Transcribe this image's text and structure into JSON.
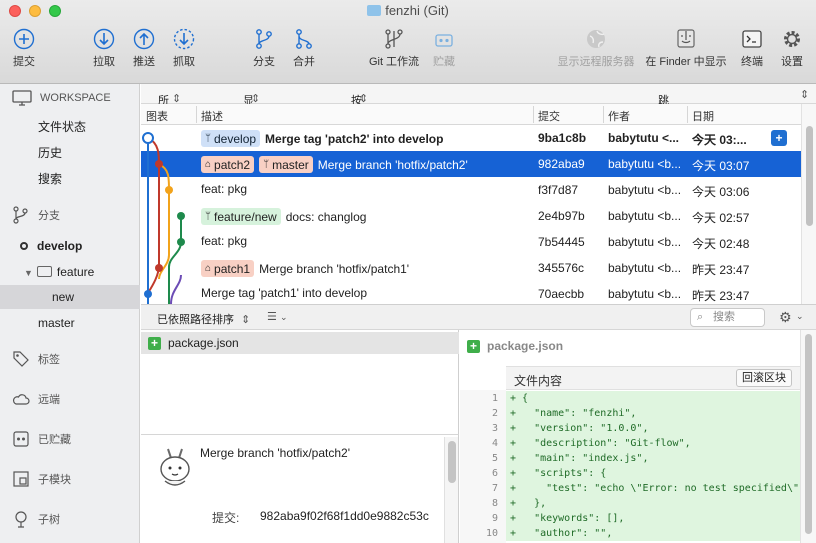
{
  "window": {
    "title": "fenzhi (Git)"
  },
  "toolbar": {
    "commit": "提交",
    "pull": "拉取",
    "push": "推送",
    "fetch": "抓取",
    "branch": "分支",
    "merge": "合并",
    "gitflow": "Git 工作流",
    "stash": "贮藏",
    "remote": "显示远程服务器",
    "finder": "在 Finder 中显示",
    "terminal": "终端",
    "settings": "设置"
  },
  "sidebar": {
    "workspace": "WORKSPACE",
    "workspace_items": [
      "文件状态",
      "历史",
      "搜索"
    ],
    "branches_header": "分支",
    "branches": {
      "develop": "develop",
      "feature": "feature",
      "new": "new",
      "master": "master"
    },
    "tags": "标签",
    "remotes": "远端",
    "stashes": "已贮藏",
    "submodules": "子模块",
    "subtrees": "子树"
  },
  "filterbar": {
    "all_branches": "所有分支",
    "show_remote": "显示远程分支",
    "date_order": "按日期排序",
    "jump_to": "跳转到:"
  },
  "columns": {
    "graph": "图表",
    "desc": "描述",
    "commit": "提交",
    "author": "作者",
    "date": "日期"
  },
  "commits": [
    {
      "refs": [
        {
          "label": "develop",
          "kind": "branch",
          "color": "blue"
        }
      ],
      "message": "Merge tag 'patch2' into develop",
      "hash": "9ba1c8b",
      "author": "babytutu <...",
      "date": "今天 03:..."
    },
    {
      "refs": [
        {
          "label": "patch2",
          "kind": "tag",
          "color": "red"
        },
        {
          "label": "master",
          "kind": "branch",
          "color": "red"
        }
      ],
      "message": "Merge branch 'hotfix/patch2'",
      "hash": "982aba9",
      "author": "babytutu <b...",
      "date": "今天 03:07"
    },
    {
      "refs": [],
      "message": "feat: pkg",
      "hash": "f3f7d87",
      "author": "babytutu <b...",
      "date": "今天 03:06"
    },
    {
      "refs": [
        {
          "label": "feature/new",
          "kind": "branch",
          "color": "green"
        }
      ],
      "message": "docs: changlog",
      "hash": "2e4b97b",
      "author": "babytutu <b...",
      "date": "今天 02:57"
    },
    {
      "refs": [],
      "message": "feat: pkg",
      "hash": "7b54445",
      "author": "babytutu <b...",
      "date": "今天 02:48"
    },
    {
      "refs": [
        {
          "label": "patch1",
          "kind": "tag",
          "color": "red"
        }
      ],
      "message": "Merge branch 'hotfix/patch1'",
      "hash": "345576c",
      "author": "babytutu <b...",
      "date": "昨天 23:47"
    },
    {
      "refs": [],
      "message": "Merge tag 'patch1' into develop",
      "hash": "70aecbb",
      "author": "babytutu <b...",
      "date": "昨天 23:47"
    }
  ],
  "lowbar": {
    "sort": "已依照路径排序",
    "search_placeholder": "搜索"
  },
  "files": {
    "name": "package.json"
  },
  "commit_info": {
    "message": "Merge branch 'hotfix/patch2'",
    "commit_label": "提交:",
    "commit_hash": "982aba9f02f68f1dd0e9882c53c"
  },
  "diff": {
    "file": "package.json",
    "hunk_title": "文件内容",
    "hunk_button": "回滚区块",
    "lines": [
      {
        "n": "1",
        "code": "+ {"
      },
      {
        "n": "2",
        "code": "+   \"name\": \"fenzhi\","
      },
      {
        "n": "3",
        "code": "+   \"version\": \"1.0.0\","
      },
      {
        "n": "4",
        "code": "+   \"description\": \"Git-flow\","
      },
      {
        "n": "5",
        "code": "+   \"main\": \"index.js\","
      },
      {
        "n": "6",
        "code": "+   \"scripts\": {"
      },
      {
        "n": "7",
        "code": "+     \"test\": \"echo \\\"Error: no test specified\\\""
      },
      {
        "n": "8",
        "code": "+   },"
      },
      {
        "n": "9",
        "code": "+   \"keywords\": [],"
      },
      {
        "n": "10",
        "code": "+   \"author\": \"\","
      }
    ]
  },
  "colors": {
    "accent": "#1662d5",
    "graph_blue": "#1f6fd1",
    "graph_red": "#c0392b",
    "graph_orange": "#f2a31b",
    "graph_green": "#1e8a4c",
    "graph_purple": "#6c4cb5"
  }
}
